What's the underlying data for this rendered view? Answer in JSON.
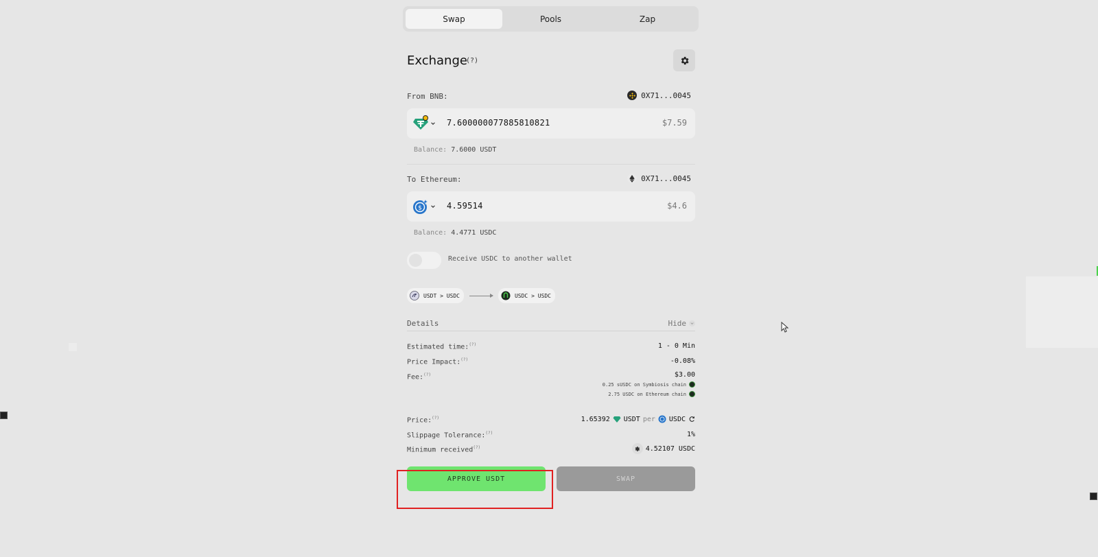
{
  "tabs": [
    {
      "label": "Swap",
      "active": true
    },
    {
      "label": "Pools",
      "active": false
    },
    {
      "label": "Zap",
      "active": false
    }
  ],
  "exchange": {
    "title": "Exchange",
    "help": "(?)"
  },
  "from": {
    "label": "From BNB:",
    "address": "0X71...0045",
    "amount": "7.600000077885810821",
    "usd": "$7.59",
    "balance_label": "Balance:",
    "balance_value": "7.6000 USDT"
  },
  "to": {
    "label": "To Ethereum:",
    "address": "0X71...0045",
    "amount": "4.59514",
    "usd": "$4.6",
    "balance_label": "Balance:",
    "balance_value": "4.4771 USDC"
  },
  "receive_toggle": {
    "label": "Receive USDC to another wallet",
    "on": false
  },
  "route": {
    "step1": "USDT > USDC",
    "step2": "USDC > USDC"
  },
  "details": {
    "label": "Details",
    "hide_label": "Hide",
    "estimated_time_label": "Estimated time:",
    "estimated_time_value": "1 - 0 Min",
    "price_impact_label": "Price Impact:",
    "price_impact_value": "-0.08%",
    "fee_label": "Fee:",
    "fee_value": "$3.00",
    "fee_line1": "0.25 sUSDC on Symbiosis chain",
    "fee_line2": "2.75 USDC on Ethereum chain",
    "price_label": "Price:",
    "price_amount": "1.65392",
    "price_base": "USDT",
    "price_per": "per",
    "price_quote": "USDC",
    "slippage_label": "Slippage Tolerance:",
    "slippage_value": "1%",
    "min_received_label": "Minimum received",
    "min_received_value": "4.52107 USDC",
    "help": "(?)"
  },
  "buttons": {
    "approve": "APPROVE USDT",
    "swap": "SWAP"
  },
  "colors": {
    "background": "#e6e6e6",
    "approve_green": "#6fe46f",
    "swap_disabled": "#9a9a9a",
    "highlight_red": "#e02020"
  }
}
